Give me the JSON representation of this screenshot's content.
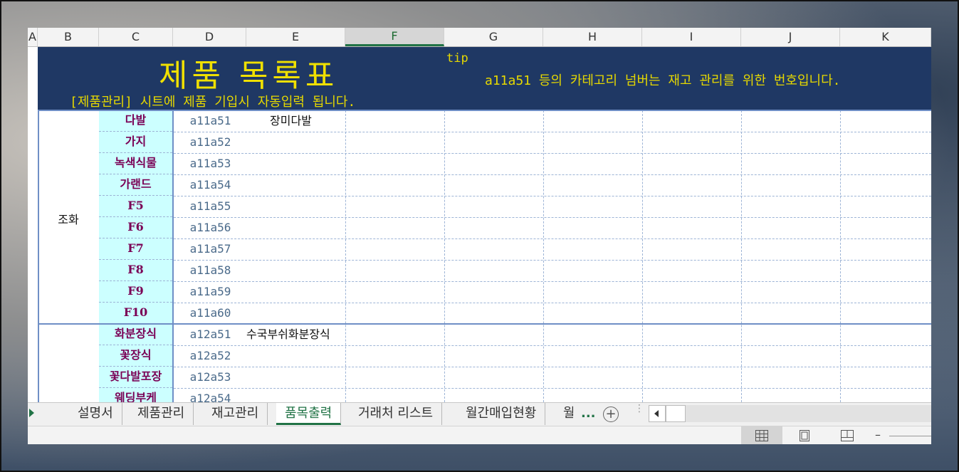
{
  "columns": [
    "A",
    "B",
    "C",
    "D",
    "E",
    "F",
    "G",
    "H",
    "I",
    "J",
    "K"
  ],
  "selected_column": "F",
  "banner": {
    "title": "제품 목록표",
    "subtitle": "[제품관리] 시트에 제품 기입시 자동입력 됩니다.",
    "tip_label": "tip",
    "tip_message": "a11a51 등의 카테고리 넘버는 재고 관리를 위한 번호입니다."
  },
  "groups": [
    {
      "label": "조화",
      "rows": [
        {
          "category": "다발",
          "code": "a11a51",
          "name": "장미다발"
        },
        {
          "category": "가지",
          "code": "a11a52",
          "name": ""
        },
        {
          "category": "녹색식물",
          "code": "a11a53",
          "name": ""
        },
        {
          "category": "가랜드",
          "code": "a11a54",
          "name": ""
        },
        {
          "category": "F5",
          "code": "a11a55",
          "name": ""
        },
        {
          "category": "F6",
          "code": "a11a56",
          "name": ""
        },
        {
          "category": "F7",
          "code": "a11a57",
          "name": ""
        },
        {
          "category": "F8",
          "code": "a11a58",
          "name": ""
        },
        {
          "category": "F9",
          "code": "a11a59",
          "name": ""
        },
        {
          "category": "F10",
          "code": "a11a60",
          "name": ""
        }
      ]
    },
    {
      "label": "",
      "rows": [
        {
          "category": "화분장식",
          "code": "a12a51",
          "name": "수국부쉬화분장식"
        },
        {
          "category": "꽃장식",
          "code": "a12a52",
          "name": ""
        },
        {
          "category": "꽃다발포장",
          "code": "a12a53",
          "name": ""
        },
        {
          "category": "웨딩부케",
          "code": "a12a54",
          "name": ""
        }
      ]
    }
  ],
  "sheet_tabs": [
    "설명서",
    "제품관리",
    "재고관리",
    "품목출력",
    "거래처 리스트",
    "월간매입현황",
    "월"
  ],
  "active_tab": "품목출력",
  "more_label": "...",
  "add_sheet_label": "+",
  "status": {
    "views": [
      "normal-view",
      "page-layout-view",
      "page-break-view"
    ],
    "active_view": "normal-view",
    "zoom_minus": "–"
  }
}
